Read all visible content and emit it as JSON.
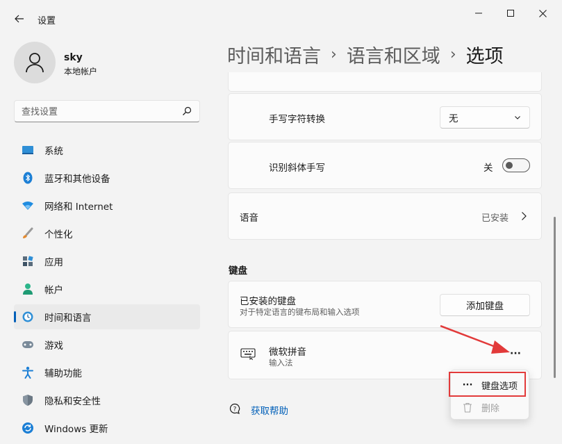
{
  "window": {
    "title": "设置",
    "controls": [
      "minimize",
      "maximize",
      "close"
    ]
  },
  "user": {
    "name": "sky",
    "account_type": "本地帐户"
  },
  "search": {
    "placeholder": "查找设置"
  },
  "nav": {
    "items": [
      {
        "label": "系统",
        "icon": "system-icon"
      },
      {
        "label": "蓝牙和其他设备",
        "icon": "bluetooth-icon"
      },
      {
        "label": "网络和 Internet",
        "icon": "network-icon"
      },
      {
        "label": "个性化",
        "icon": "brush-icon"
      },
      {
        "label": "应用",
        "icon": "apps-icon"
      },
      {
        "label": "帐户",
        "icon": "account-icon"
      },
      {
        "label": "时间和语言",
        "icon": "time-language-icon",
        "active": true
      },
      {
        "label": "游戏",
        "icon": "gamepad-icon"
      },
      {
        "label": "辅助功能",
        "icon": "accessibility-icon"
      },
      {
        "label": "隐私和安全性",
        "icon": "shield-icon"
      },
      {
        "label": "Windows 更新",
        "icon": "update-icon"
      }
    ]
  },
  "breadcrumb": {
    "items": [
      "时间和语言",
      "语言和区域",
      "选项"
    ]
  },
  "handwriting": {
    "convert_label": "手写字符转换",
    "convert_value": "无",
    "italic_label": "识别斜体手写",
    "italic_state": "关"
  },
  "speech": {
    "label": "语音",
    "status": "已安装"
  },
  "keyboard": {
    "section_title": "键盘",
    "installed_title": "已安装的键盘",
    "installed_desc": "对于特定语言的键布局和输入选项",
    "add_button": "添加键盘",
    "item_name": "微软拼音",
    "item_type": "输入法",
    "more_glyph": "···"
  },
  "context_menu": {
    "options_label": "键盘选项",
    "delete_label": "删除"
  },
  "help": {
    "label": "获取帮助"
  },
  "colors": {
    "accent": "#005fb8",
    "annotation": "#e23a3a"
  }
}
